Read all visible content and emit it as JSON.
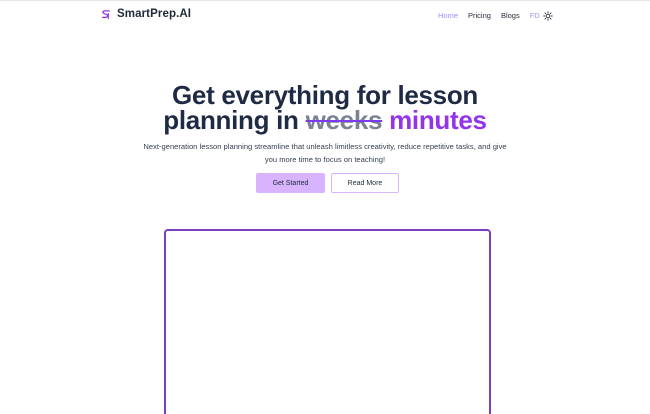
{
  "brand": {
    "name": "SmartPrep.AI",
    "logo_icon": "sp-logo-icon",
    "accent_color": "#9333ea"
  },
  "nav": {
    "items": [
      {
        "label": "Home",
        "active": true
      },
      {
        "label": "Pricing",
        "active": false
      },
      {
        "label": "Blogs",
        "active": false
      },
      {
        "label": "FD",
        "active": false
      }
    ],
    "theme_toggle_icon": "sun-icon"
  },
  "hero": {
    "title_line1": "Get everything for lesson",
    "title_line2_prefix": "planning in",
    "title_struck": "weeks",
    "title_accent": "minutes",
    "subtitle": "Next-generation lesson planning streamline that unleash limitless creativity, reduce repetitive tasks, and give you more time to focus on teaching!",
    "primary_button": "Get Started",
    "secondary_button": "Read More"
  },
  "colors": {
    "primary_button_bg": "#d8b4fe",
    "frame_border": "#7e3fbf",
    "nav_active": "#a78bfa"
  }
}
